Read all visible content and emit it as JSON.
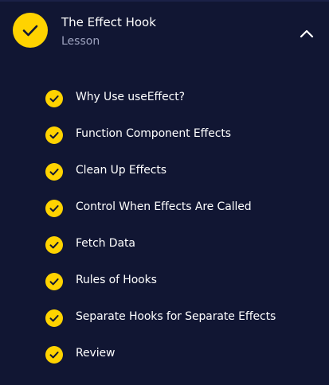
{
  "lesson": {
    "title": "The Effect Hook",
    "type_label": "Lesson",
    "status_icon": "check-circle-icon",
    "toggle_icon": "chevron-up-icon",
    "accent_color": "#ffd300",
    "background_color": "#111633"
  },
  "items": [
    {
      "label": "Why Use useEffect?",
      "completed": true
    },
    {
      "label": "Function Component Effects",
      "completed": true
    },
    {
      "label": "Clean Up Effects",
      "completed": true
    },
    {
      "label": "Control When Effects Are Called",
      "completed": true
    },
    {
      "label": "Fetch Data",
      "completed": true
    },
    {
      "label": "Rules of Hooks",
      "completed": true
    },
    {
      "label": "Separate Hooks for Separate Effects",
      "completed": true
    },
    {
      "label": "Review",
      "completed": true
    }
  ]
}
